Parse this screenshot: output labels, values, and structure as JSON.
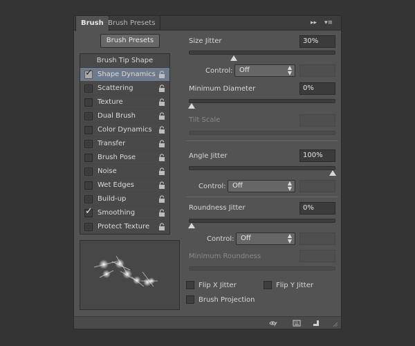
{
  "tabs": {
    "brush": "Brush",
    "brush_presets": "Brush Presets"
  },
  "tab_controls": {
    "collapse": "▸▸",
    "menu": "▾≡"
  },
  "presets_button": "Brush Presets",
  "list": {
    "header": "Brush Tip Shape",
    "items": [
      {
        "label": "Shape Dynamics",
        "checked": true,
        "selected": true
      },
      {
        "label": "Scattering",
        "checked": false
      },
      {
        "label": "Texture",
        "checked": false
      },
      {
        "label": "Dual Brush",
        "checked": false
      },
      {
        "label": "Color Dynamics",
        "checked": false
      },
      {
        "label": "Transfer",
        "checked": false
      },
      {
        "label": "Brush Pose",
        "checked": false
      },
      {
        "label": "Noise",
        "checked": false
      },
      {
        "label": "Wet Edges",
        "checked": false
      },
      {
        "label": "Build-up",
        "checked": false
      },
      {
        "label": "Smoothing",
        "checked": true
      },
      {
        "label": "Protect Texture",
        "checked": false
      }
    ]
  },
  "settings": {
    "size_jitter": {
      "label": "Size Jitter",
      "value": "30%",
      "level": 0.3
    },
    "control1": {
      "label": "Control:",
      "value": "Off"
    },
    "minimum_diameter": {
      "label": "Minimum Diameter",
      "value": "0%",
      "level": 0
    },
    "tilt_scale": {
      "label": "Tilt Scale"
    },
    "angle_jitter": {
      "label": "Angle Jitter",
      "value": "100%",
      "level": 1
    },
    "control2": {
      "label": "Control:",
      "value": "Off"
    },
    "roundness_jitter": {
      "label": "Roundness Jitter",
      "value": "0%",
      "level": 0
    },
    "control3": {
      "label": "Control:",
      "value": "Off"
    },
    "minimum_roundness": {
      "label": "Minimum Roundness"
    },
    "flip_x": {
      "label": "Flip X Jitter"
    },
    "flip_y": {
      "label": "Flip Y Jitter"
    },
    "brush_projection": {
      "label": "Brush Projection"
    }
  },
  "colors": {
    "panel": "#535353",
    "selection": "#6f7b8c",
    "background": "#343434"
  },
  "icons": [
    "lock-icon",
    "eye-brush-icon",
    "grid-icon",
    "new-preset-icon",
    "resize-grip-icon"
  ]
}
